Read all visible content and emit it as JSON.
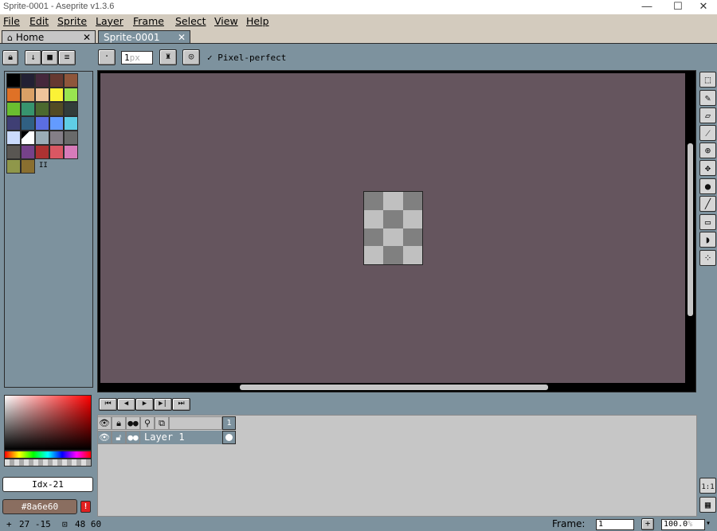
{
  "window": {
    "title": "Sprite-0001 - Aseprite v1.3.6",
    "minimize": "—",
    "maximize": "☐",
    "close": "✕"
  },
  "menu": [
    "File",
    "Edit",
    "Sprite",
    "Layer",
    "Frame",
    "Select",
    "View",
    "Help"
  ],
  "tabs": [
    {
      "label": "Home",
      "icon": "home-icon",
      "close": "✕"
    },
    {
      "label": "Sprite-0001",
      "close": "✕"
    }
  ],
  "toolbar": {
    "brush_size": "1",
    "brush_unit": "px",
    "pixel_perfect_label": "Pixel-perfect",
    "pixel_perfect_checked": true
  },
  "palette": {
    "colors": [
      "#000000",
      "#222034",
      "#45283c",
      "#663931",
      "#8f563b",
      "#df7126",
      "#d9a066",
      "#eec39a",
      "#fbf236",
      "#99e550",
      "#6abe30",
      "#37946e",
      "#4b692f",
      "#524b24",
      "#323c39",
      "#3f3f74",
      "#306082",
      "#5b6ee1",
      "#639bff",
      "#5fcde4",
      "#cbdbfc",
      "#ffffff",
      "#9badb7",
      "#847e87",
      "#696a6a",
      "#595652",
      "#76428a",
      "#ac3232",
      "#d95763",
      "#d77bba",
      "#8f974a",
      "#8a6f30"
    ],
    "selected_index": 21,
    "marker": "II"
  },
  "color": {
    "index_label": "Idx-21",
    "hex_label": "#8a6e60",
    "fg_swatch": "#8a6e60",
    "warning_glyph": "!"
  },
  "canvas": {
    "background": "#65555e",
    "checker": [
      "#808080",
      "#c0c0c0"
    ]
  },
  "tools": [
    "rectangular-marquee",
    "pencil",
    "eraser",
    "eyedropper",
    "zoom",
    "move",
    "paint-bucket",
    "line",
    "rectangle",
    "contour",
    "spray"
  ],
  "timeline": {
    "controls": [
      "⏮",
      "◀",
      "▶",
      "▶|",
      "⏭"
    ],
    "frame_header": "1",
    "layers": [
      {
        "name": "Layer 1",
        "visible": true,
        "locked": false
      }
    ]
  },
  "right_bottom": {
    "ratio": "1:1"
  },
  "status": {
    "cursor": "27 -15",
    "size": "48 60",
    "frame_label": "Frame:",
    "frame_value": "1",
    "add_frame": "+",
    "zoom_value": "100.0",
    "zoom_unit": "%"
  }
}
